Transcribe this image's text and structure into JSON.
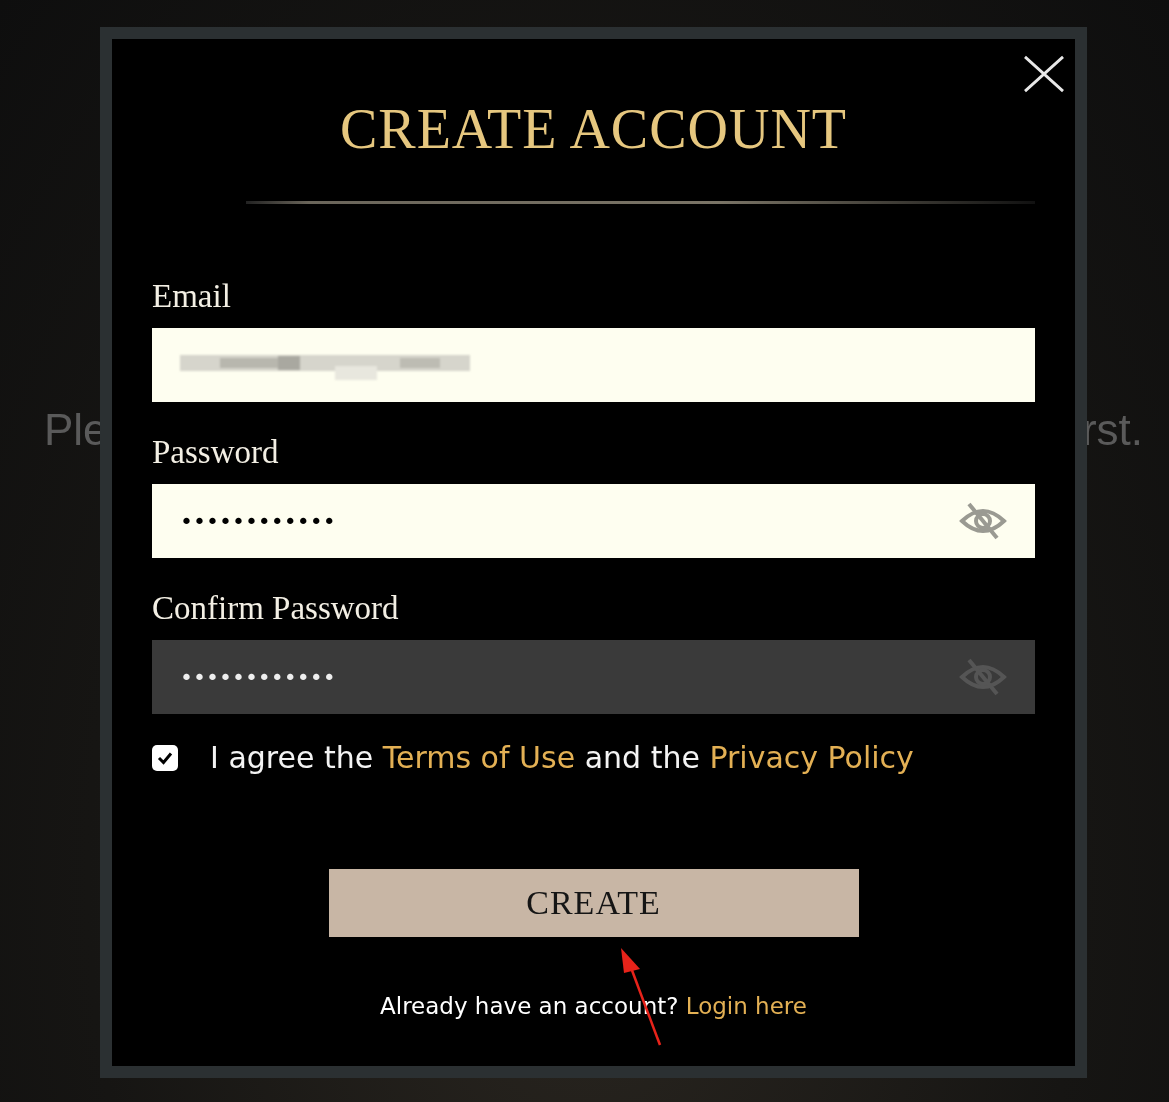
{
  "background_text": [
    "Ple",
    "rst."
  ],
  "dialog": {
    "title": "CREATE ACCOUNT",
    "fields": [
      {
        "kind": "email",
        "label": "Email",
        "redacted": true,
        "autofilled": true,
        "reveal_toggle": false
      },
      {
        "kind": "password",
        "label": "Password",
        "value": "••••••••••••",
        "autofilled": true,
        "reveal_toggle": true
      },
      {
        "kind": "password",
        "label": "Confirm Password",
        "value": "••••••••••••",
        "autofilled": false,
        "reveal_toggle": true
      }
    ],
    "agreement": {
      "checked": true,
      "parts": [
        {
          "kind": "text",
          "text": "I agree the"
        },
        {
          "kind": "link",
          "text": "Terms of Use"
        },
        {
          "kind": "text",
          "text": "and the"
        },
        {
          "kind": "link",
          "text": "Privacy Policy"
        }
      ]
    },
    "submit_button": "CREATE",
    "footer": {
      "text": "Already have an account?",
      "link": "Login here"
    },
    "annotation_arrow": true
  }
}
